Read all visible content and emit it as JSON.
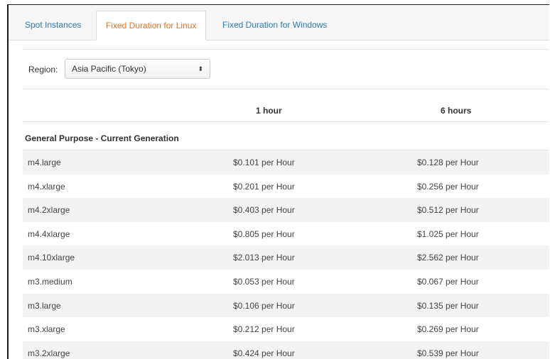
{
  "tabs": [
    {
      "label": "Spot Instances"
    },
    {
      "label": "Fixed Duration for Linux"
    },
    {
      "label": "Fixed Duration for Windows"
    }
  ],
  "region": {
    "label": "Region:",
    "selected": "Asia Pacific (Tokyo)"
  },
  "columns": [
    "",
    "1 hour",
    "6 hours"
  ],
  "group": "General Purpose - Current Generation",
  "rows": [
    {
      "instance": "m4.large",
      "h1": "$0.101 per Hour",
      "h6": "$0.128 per Hour"
    },
    {
      "instance": "m4.xlarge",
      "h1": "$0.201 per Hour",
      "h6": "$0.256 per Hour"
    },
    {
      "instance": "m4.2xlarge",
      "h1": "$0.403 per Hour",
      "h6": "$0.512 per Hour"
    },
    {
      "instance": "m4.4xlarge",
      "h1": "$0.805 per Hour",
      "h6": "$1.025 per Hour"
    },
    {
      "instance": "m4.10xlarge",
      "h1": "$2.013 per Hour",
      "h6": "$2.562 per Hour"
    },
    {
      "instance": "m3.medium",
      "h1": "$0.053 per Hour",
      "h6": "$0.067 per Hour"
    },
    {
      "instance": "m3.large",
      "h1": "$0.106 per Hour",
      "h6": "$0.135 per Hour"
    },
    {
      "instance": "m3.xlarge",
      "h1": "$0.212 per Hour",
      "h6": "$0.269 per Hour"
    },
    {
      "instance": "m3.2xlarge",
      "h1": "$0.424 per Hour",
      "h6": "$0.539 per Hour"
    }
  ],
  "colors": {
    "tab_link": "#2b7bb9",
    "tab_active": "#e6732a",
    "row_stripe": "#f3f3f3"
  }
}
